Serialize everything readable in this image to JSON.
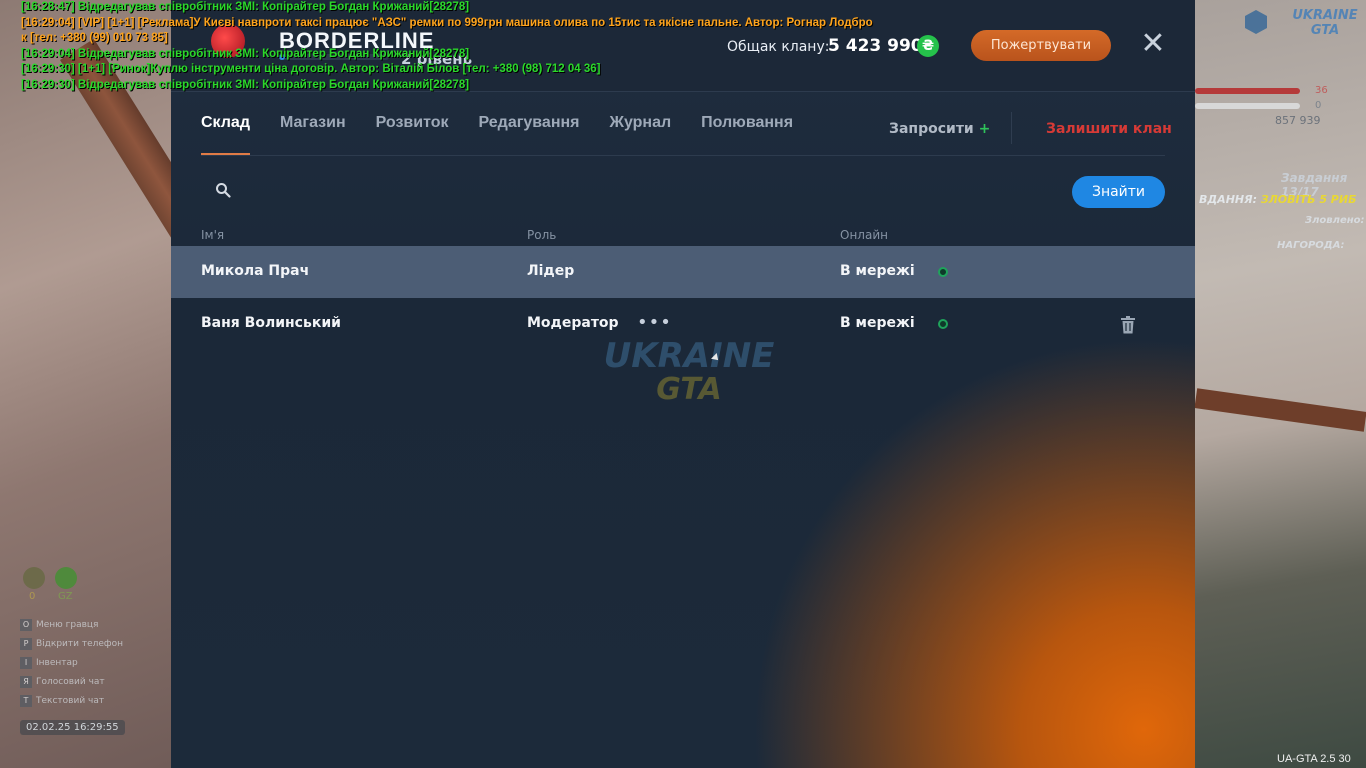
{
  "clan": {
    "name": "BORDERLINE",
    "level_label": "2 рівень",
    "level_progress": 0.05,
    "bank_label": "Общак клану:",
    "bank_value": "5 423 990",
    "bank_currency_symbol": "₴",
    "donate_label": "Пожертвувати",
    "close_symbol": "✕"
  },
  "tabs": [
    {
      "label": "Склад",
      "active": true
    },
    {
      "label": "Магазин",
      "active": false
    },
    {
      "label": "Розвиток",
      "active": false
    },
    {
      "label": "Редагування",
      "active": false
    },
    {
      "label": "Журнал",
      "active": false
    },
    {
      "label": "Полювання",
      "active": false
    }
  ],
  "actions": {
    "invite_label": "Запросити",
    "invite_plus": "+",
    "leave_label": "Залишити клан"
  },
  "search": {
    "placeholder": "",
    "button_label": "Знайти"
  },
  "table": {
    "headers": {
      "name": "Ім'я",
      "role": "Роль",
      "online": "Онлайн"
    },
    "rows": [
      {
        "name": "Микола Прач",
        "role": "Лідер",
        "online": "В мережі",
        "highlight": true
      },
      {
        "name": "Ваня Волинський",
        "role": "Модератор",
        "online": "В мережі",
        "highlight": false,
        "more": "•••"
      }
    ]
  },
  "watermark": {
    "line1": "UKRAINE",
    "line2": "GTA"
  },
  "chat": [
    {
      "text": "[16:28:47] Відредагував співробітник ЗМІ: Копірайтер Богдан Крижаний[28278]",
      "color": "green"
    },
    {
      "text": "[16:29:04] [VIP] [1+1] [Реклама]У Києві навпроти таксі працює \"АЗС\" ремки по 999грн машина олива по 15тис та якісне пальне. Автор: Рогнар Лодбро",
      "color": "orange"
    },
    {
      "text": "к [тел: +380 (99) 010 73 85]",
      "color": "orange"
    },
    {
      "text": "[16:29:04] Відредагував співробітник ЗМІ: Копірайтер Богдан Крижаний[28278]",
      "color": "green"
    },
    {
      "text": "[16:29:30] [1+1] [Ринок]Куплю інструменти ціна договір. Автор: Віталій Білов [тел: +380 (98) 712 04 36]",
      "color": "green"
    },
    {
      "text": "[16:29:30] Відредагував співробітник ЗМІ: Копірайтер Богдан Крижаний[28278]",
      "color": "green"
    }
  ],
  "hud_right": {
    "logo_line1": "UKRAINE",
    "logo_line2": "GTA",
    "health": "36",
    "armor": "0",
    "money": "857 939",
    "task_title": "Завдання 13/17",
    "task_prefix": "ВДАННЯ:",
    "task_text": "ЗЛОВІТЬ 5 РИБ",
    "caught": "Зловлено: 0/5",
    "reward": "НАГОРОДА:"
  },
  "hud_left": {
    "stat1": "0",
    "stat2": "GZ",
    "keys": [
      {
        "key": "O",
        "label": "Меню гравця"
      },
      {
        "key": "P",
        "label": "Відкрити телефон"
      },
      {
        "key": "I",
        "label": "Інвентар"
      },
      {
        "key": "Я",
        "label": "Голосовий чат"
      },
      {
        "key": "T",
        "label": "Текстовий чат"
      }
    ],
    "datetime": "02.02.25 16:29:55"
  },
  "version": "UA-GTA 2.5   30"
}
